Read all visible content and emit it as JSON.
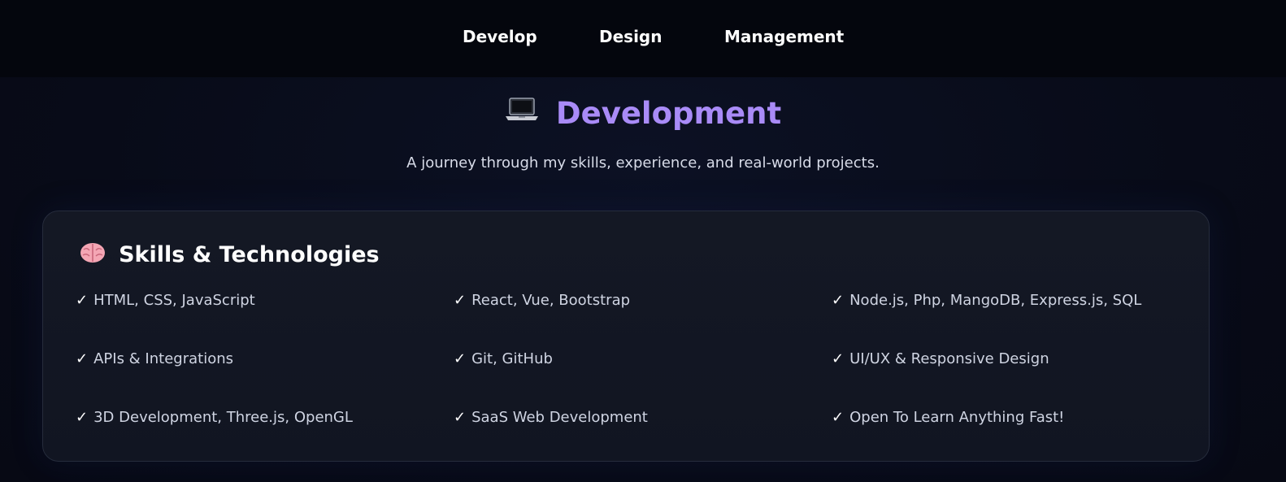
{
  "nav": {
    "items": [
      {
        "label": "Develop"
      },
      {
        "label": "Design"
      },
      {
        "label": "Management"
      }
    ]
  },
  "header": {
    "icon": "laptop-icon",
    "title": "Development",
    "subtitle": "A journey through my skills, experience, and real-world projects."
  },
  "skills": {
    "icon": "brain-icon",
    "title": "Skills & Technologies",
    "check_mark": "✓",
    "items": [
      "HTML, CSS, JavaScript",
      "React, Vue, Bootstrap",
      "Node.js, Php, MangoDB, Express.js, SQL",
      "APIs & Integrations",
      "Git, GitHub",
      "UI/UX & Responsive Design",
      "3D Development, Three.js, OpenGL",
      "SaaS Web Development",
      "Open To Learn Anything Fast!"
    ]
  },
  "colors": {
    "page_background": "#070a16",
    "nav_background": "#04060d",
    "accent_title": "#a98bf7",
    "card_background": "#141824",
    "card_border": "#262c3c",
    "body_text": "#cfd4e2"
  }
}
